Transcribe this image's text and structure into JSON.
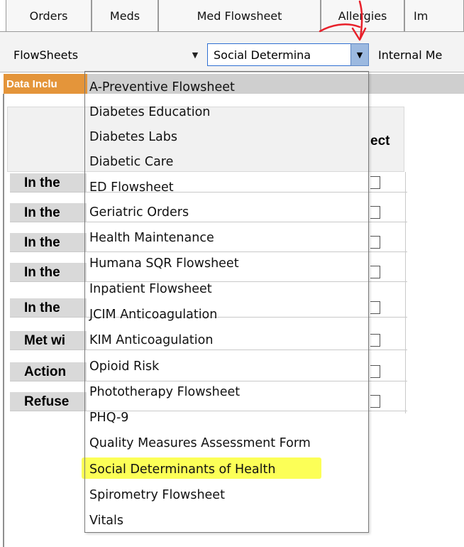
{
  "tabs": [
    "Orders",
    "Meds",
    "Med Flowsheet",
    "Allergies",
    "Im"
  ],
  "toolbar": {
    "flowsheets_select": "FlowSheets",
    "flowsheet_select": "Social Determina",
    "specialty_select": "Internal Me"
  },
  "section": {
    "data_label": "Data Inclu",
    "select_header": "ect"
  },
  "rows": [
    {
      "label": "In the"
    },
    {
      "label": "In the"
    },
    {
      "label": "In the"
    },
    {
      "label": "In the"
    },
    {
      "label": "In the"
    },
    {
      "label": "Met wi"
    },
    {
      "label": "Action"
    },
    {
      "label": "Refuse"
    }
  ],
  "dropdown": {
    "options": [
      "A-Preventive Flowsheet",
      "Diabetes Education",
      "Diabetes Labs",
      "Diabetic Care",
      "ED Flowsheet",
      "Geriatric Orders",
      "Health Maintenance",
      "Humana SQR Flowsheet",
      "Inpatient Flowsheet",
      "JCIM Anticoagulation",
      "KIM Anticoagulation",
      "Opioid Risk",
      "Phototherapy Flowsheet",
      "PHQ-9",
      "Quality Measures Assessment Form",
      "Social Determinants of Health",
      "Spirometry Flowsheet",
      "Vitals"
    ],
    "highlighted_option": "Social Determinants of Health"
  },
  "icons": {
    "dropdown_arrow": "chevron-down-icon"
  },
  "colors": {
    "section_label_bg": "#e4953a",
    "highlight": "#fbff3a",
    "annotation": "#e8202a",
    "active_dropdown_button": "#9cb9e0"
  }
}
